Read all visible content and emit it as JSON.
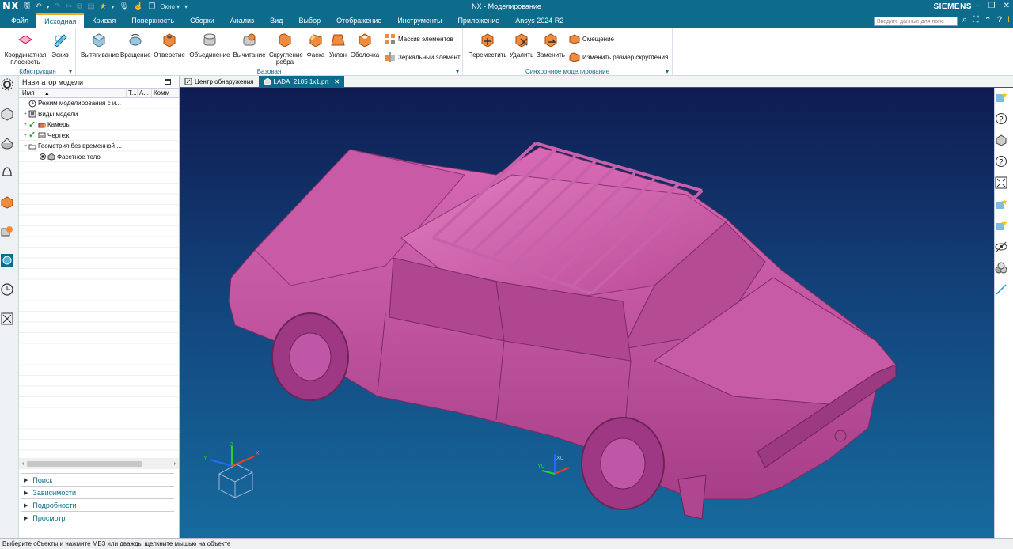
{
  "app": {
    "logo": "NX",
    "title": "NX - Моделирование",
    "brand": "SIEMENS",
    "window_menu": "Окно"
  },
  "menu": {
    "items": [
      "Файл",
      "Исходная",
      "Кривая",
      "Поверхность",
      "Сборки",
      "Анализ",
      "Вид",
      "Выбор",
      "Отображение",
      "Инструменты",
      "Приложение",
      "Ansys 2024 R2"
    ],
    "active": "Исходная",
    "search_placeholder": "Введите данные для поис"
  },
  "ribbon": {
    "groups": [
      {
        "label": "Конструкция",
        "buttons": [
          "Координатная плоскость",
          "Эскиз"
        ]
      },
      {
        "label": "Базовая",
        "buttons": [
          "Вытягивание",
          "Вращение",
          "Отверстие",
          "Объединение",
          "Вычитание",
          "Скругление ребра",
          "Фаска",
          "Уклон",
          "Оболочка"
        ],
        "small": [
          "Массив элементов",
          "Зеркальный элемент"
        ]
      },
      {
        "label": "Синхронное моделирование",
        "buttons": [
          "Переместить",
          "Удалить",
          "Заменить"
        ],
        "small": [
          "Смещение",
          "Изменить размер скругления"
        ]
      }
    ]
  },
  "navigator": {
    "title": "Навигатор модели",
    "columns": [
      "Имя",
      "Т...",
      "А...",
      "Комм"
    ],
    "rows": [
      {
        "label": "Режим моделирования с и..."
      },
      {
        "label": "Виды модели"
      },
      {
        "label": "Камеры"
      },
      {
        "label": "Чертеж"
      },
      {
        "label": "Геометрия без временной ..."
      },
      {
        "label": "Фасетное тело"
      }
    ],
    "panels": [
      "Поиск",
      "Зависимости",
      "Подробности",
      "Просмотр"
    ]
  },
  "tabs": [
    {
      "label": "Центр обнаружения"
    },
    {
      "label": "LADA_2105 1х1.prt",
      "active": true
    }
  ],
  "viewport": {
    "model_color": "#c54f9e",
    "bg_top": "#0f1c52",
    "bg_bottom": "#166b9e",
    "triad_labels": {
      "x": "X",
      "y": "Y",
      "z": "Z",
      "xc": "XC",
      "yc": "YC"
    }
  },
  "status": {
    "text": "Выберите объекты и нажмите MB3 или дважды щелкните мышью на объекте"
  },
  "colors": {
    "accent": "#0d6b8c",
    "active_tab_underline": "#f5a623"
  }
}
